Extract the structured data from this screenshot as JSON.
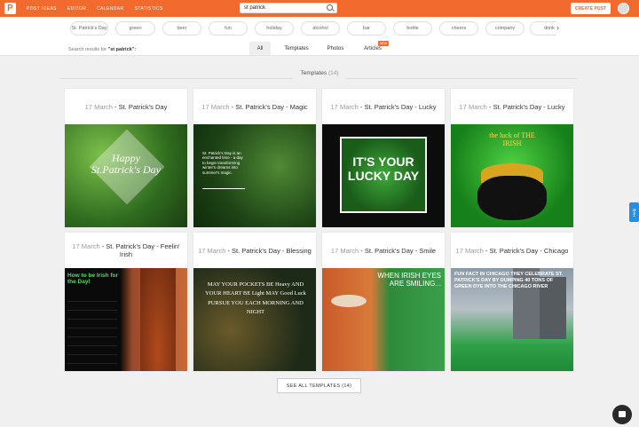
{
  "topbar": {
    "logo": "P",
    "nav": [
      "POST IDEAS",
      "EDITOR",
      "CALENDAR",
      "STATISTICS"
    ],
    "search_value": "st patrick",
    "create_label": "CREATE POST"
  },
  "chips": [
    "St. Patrick's Day",
    "green",
    "beer",
    "fun",
    "holiday",
    "alcohol",
    "bar",
    "bottle",
    "cheers",
    "company",
    "drink"
  ],
  "results": {
    "prefix": "Search results for ",
    "query": "\"st patrick\":"
  },
  "filter_tabs": [
    "All",
    "Templates",
    "Photos",
    "Articles"
  ],
  "new_badge": "NEW",
  "section": {
    "title": "Templates",
    "count": "(14)"
  },
  "cards": [
    {
      "date": "17 March",
      "title": " - St. Patrick's Day",
      "image_text": "Happy St.Patrick's Day"
    },
    {
      "date": "17 March",
      "title": " - St. Patrick's Day - Magic",
      "image_text": "St. Patrick's Day is an enchanted time - a day to begin transforming winter's dreams into summer's magic."
    },
    {
      "date": "17 March",
      "title": " - St. Patrick's Day - Lucky",
      "image_text": "IT'S YOUR LUCKY DAY"
    },
    {
      "date": "17 March",
      "title": " - St. Patrick's Day - Lucky",
      "image_text": "the luck of THE IRISH"
    },
    {
      "date": "17 March",
      "title": " - St. Patrick's Day - Feelin' Irish",
      "image_text": "How to be Irish for the Day!"
    },
    {
      "date": "17 March",
      "title": " - St. Patrick's Day - Blessing",
      "image_text": "MAY YOUR POCKETS BE Heavy AND YOUR HEART BE Light MAY Good Luck PURSUE YOU EACH MORNING AND NIGHT"
    },
    {
      "date": "17 March",
      "title": " - St. Patrick's Day - Smile",
      "image_text": "WHEN IRISH EYES ARE SMILING..."
    },
    {
      "date": "17 March",
      "title": " - St. Patrick's Day - Chicago",
      "image_text": "FUN FACT IN CHICAGO THEY CELEBRATE ST. PATRICK'S DAY BY DUMPING 40 TONS OF GREEN DYE INTO THE CHICAGO RIVER"
    }
  ],
  "see_all_label": "SEE ALL TEMPLATES (14)",
  "help_label": "Help",
  "colors": {
    "brand": "#f26a2e",
    "accent_blue": "#2a8ee0"
  }
}
